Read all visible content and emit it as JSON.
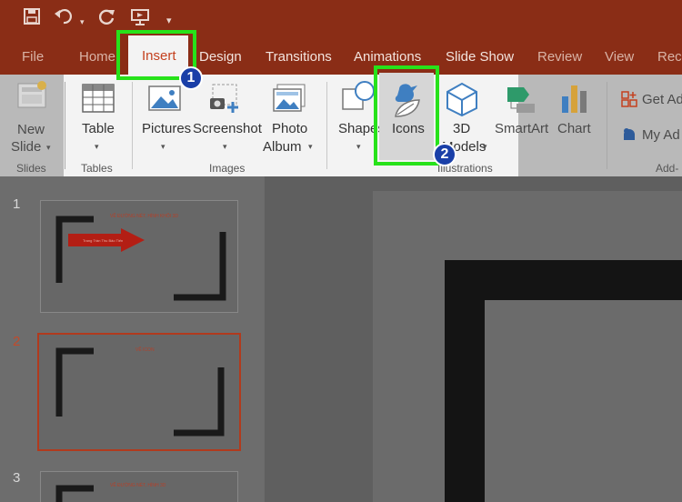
{
  "quick_access": {
    "icons": [
      "save-icon",
      "undo-icon",
      "undo-dropdown-icon",
      "repeat-icon",
      "present-icon",
      "customize-qa-icon"
    ]
  },
  "tabs": {
    "file": "File",
    "home": "Home",
    "insert": "Insert",
    "design": "Design",
    "transitions": "Transitions",
    "animations": "Animations",
    "slide_show": "Slide Show",
    "review": "Review",
    "view": "View",
    "record": "Reco"
  },
  "ribbon": {
    "new_slide": [
      "New",
      "Slide"
    ],
    "table": "Table",
    "pictures": "Pictures",
    "screenshot": "Screenshot",
    "photo_album": [
      "Photo",
      "Album"
    ],
    "shapes": "Shapes",
    "icons": "Icons",
    "models_3d": [
      "3D",
      "Models"
    ],
    "smartart": "SmartArt",
    "chart": "Chart",
    "get_addins": "Get Ad",
    "my_addins": "My Ad"
  },
  "groups": {
    "slides": "Slides",
    "tables": "Tables",
    "images": "Images",
    "illustrations": "Illustrations",
    "addins": "Add-"
  },
  "annotations": {
    "step1": "1",
    "step2": "2",
    "highlight_color": "#27e21a",
    "badge_color": "#1a3fa8"
  },
  "thumbnails": [
    {
      "number": "1",
      "title": "VẼ ĐƯỜNG NÉT, HÌNH KHỐI 3D",
      "arrow_text": "Trang Trần Thu Bảo Tiến"
    },
    {
      "number": "2",
      "title": "VẼ ICON"
    },
    {
      "number": "3",
      "title": "VẼ ĐƯỜNG NÉT, HÌNH 3D"
    }
  ],
  "colors": {
    "ribbon_tab_bar": "#8a2d16",
    "accent": "#c4401e"
  }
}
